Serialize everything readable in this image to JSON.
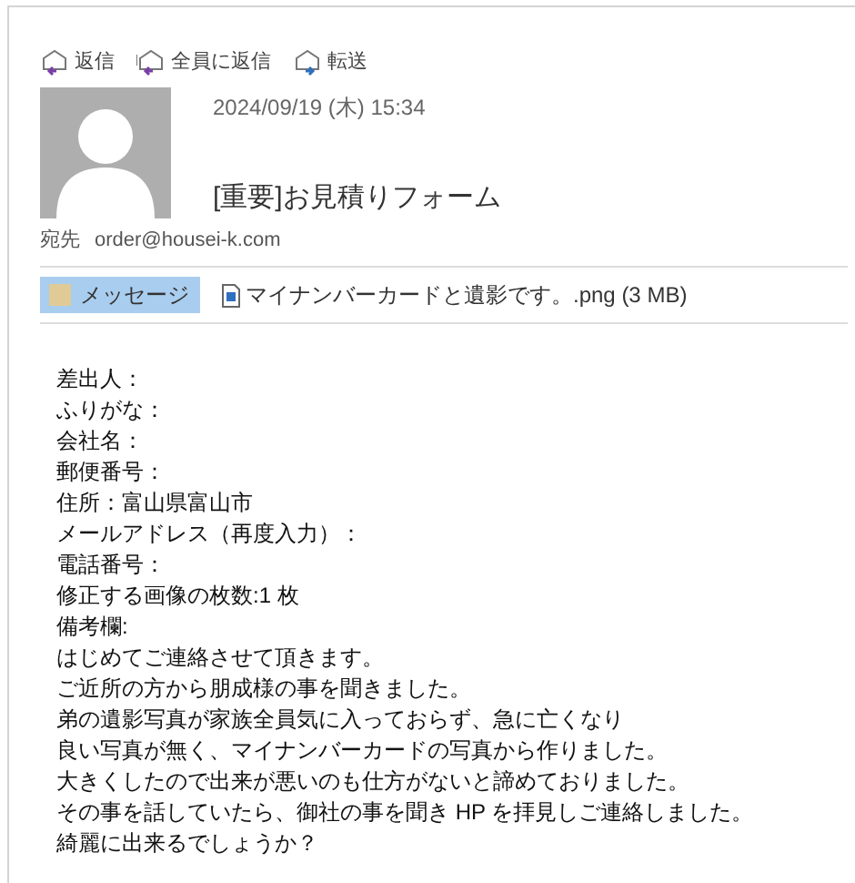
{
  "actions": [
    {
      "kind": "reply",
      "label": "返信"
    },
    {
      "kind": "reply_all",
      "label": "全員に返信"
    },
    {
      "kind": "forward",
      "label": "転送"
    }
  ],
  "message": {
    "date": "2024/09/19 (木) 15:34",
    "subject": "[重要]お見積りフォーム",
    "to_label": "宛先",
    "to": "order@housei-k.com"
  },
  "attachments": [
    {
      "kind": "message",
      "label": "メッセージ",
      "selected": true
    },
    {
      "kind": "file",
      "label": "マイナンバーカードと遺影です。.png (3 MB)",
      "selected": false
    }
  ],
  "body": [
    "差出人：",
    "ふりがな：",
    "会社名：",
    "郵便番号：",
    "住所：富山県富山市",
    "メールアドレス（再度入力）：",
    "電話番号：",
    "修正する画像の枚数:1 枚",
    "備考欄:",
    "はじめてご連絡させて頂きます。",
    "ご近所の方から朋成様の事を聞きました。",
    "弟の遺影写真が家族全員気に入っておらず、急に亡くなり",
    "良い写真が無く、マイナンバーカードの写真から作りました。",
    "大きくしたので出来が悪いのも仕方がないと諦めておりました。",
    "その事を話していたら、御社の事を聞き HP を拝見しご連絡しました。",
    "綺麗に出来るでしょうか？"
  ]
}
